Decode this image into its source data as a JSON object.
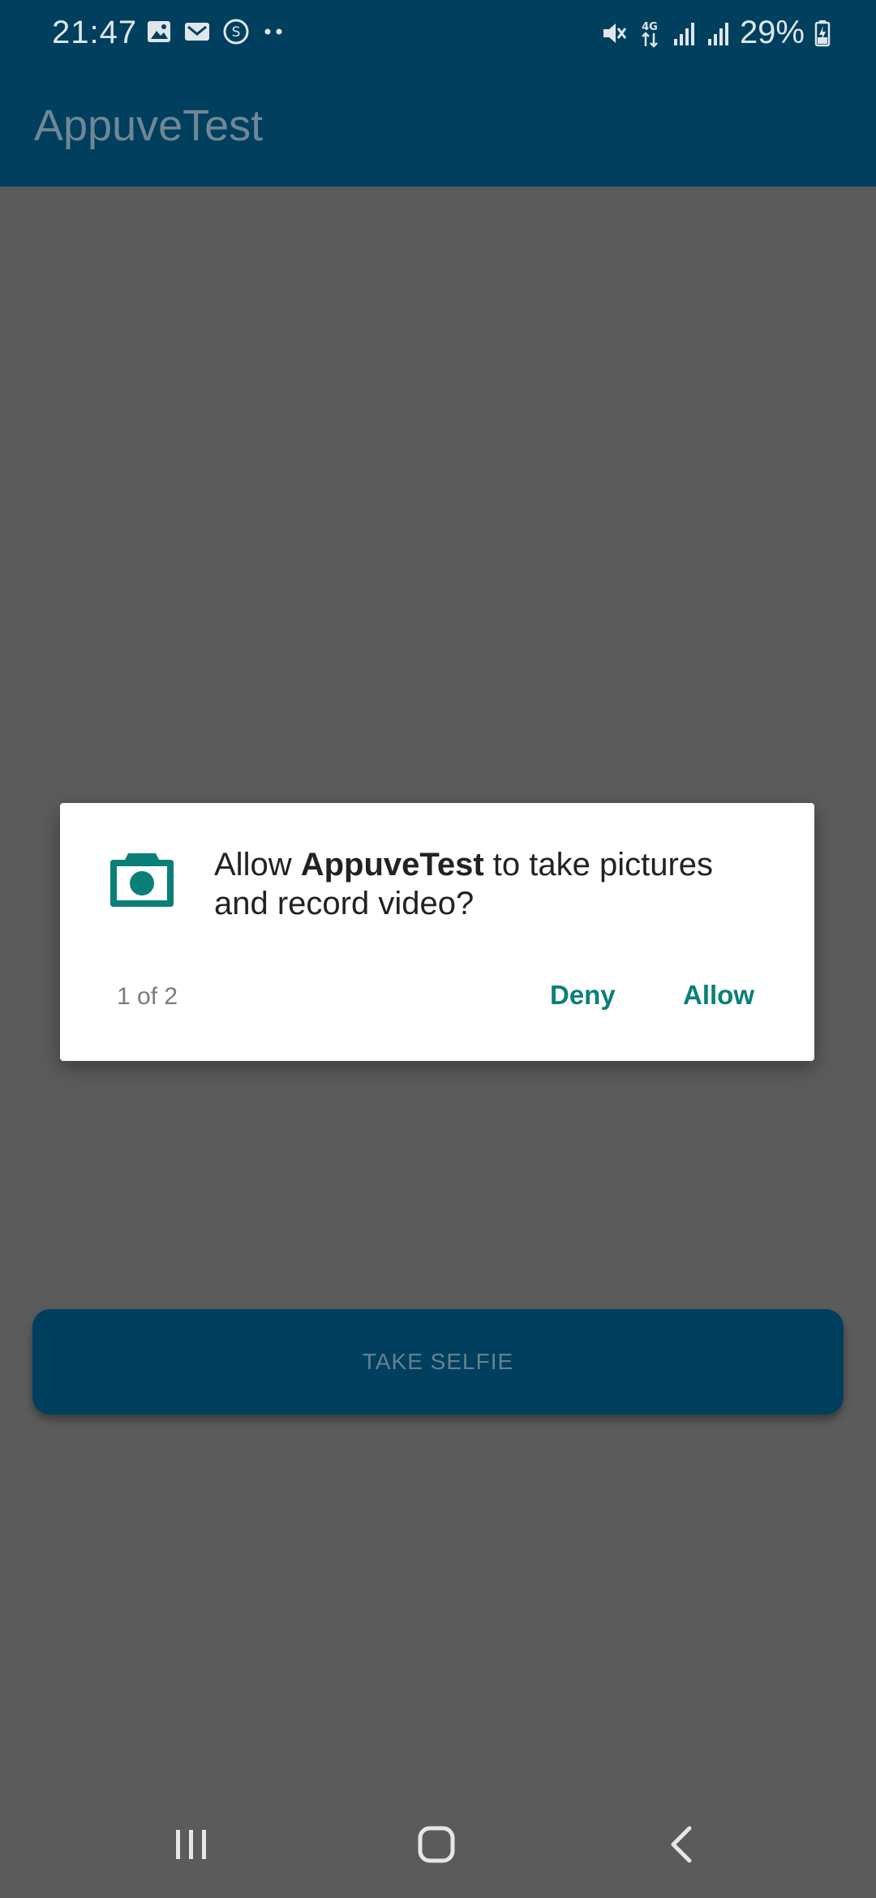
{
  "status_bar": {
    "time": "21:47",
    "battery": "29%",
    "icons_left": [
      "gallery-icon",
      "mail-icon",
      "s-icon",
      "more-dots-icon"
    ],
    "icons_right": [
      "mute-icon",
      "4g-icon",
      "signal-icon",
      "signal-icon",
      "battery-icon"
    ]
  },
  "app_bar": {
    "title": "AppuveTest"
  },
  "main": {
    "take_selfie_label": "TAKE SELFIE"
  },
  "dialog": {
    "icon": "camera-icon",
    "message_prefix": "Allow ",
    "message_app": "AppuveTest",
    "message_suffix": " to take pictures and record video?",
    "counter": "1 of 2",
    "deny_label": "Deny",
    "allow_label": "Allow"
  },
  "nav_bar": {
    "icons": [
      "recent-apps-icon",
      "home-icon",
      "back-icon"
    ]
  },
  "colors": {
    "primary": "#003f5e",
    "scrim_background": "#5b5b5b",
    "accent": "#0a7f78",
    "dialog_background": "#ffffff"
  }
}
